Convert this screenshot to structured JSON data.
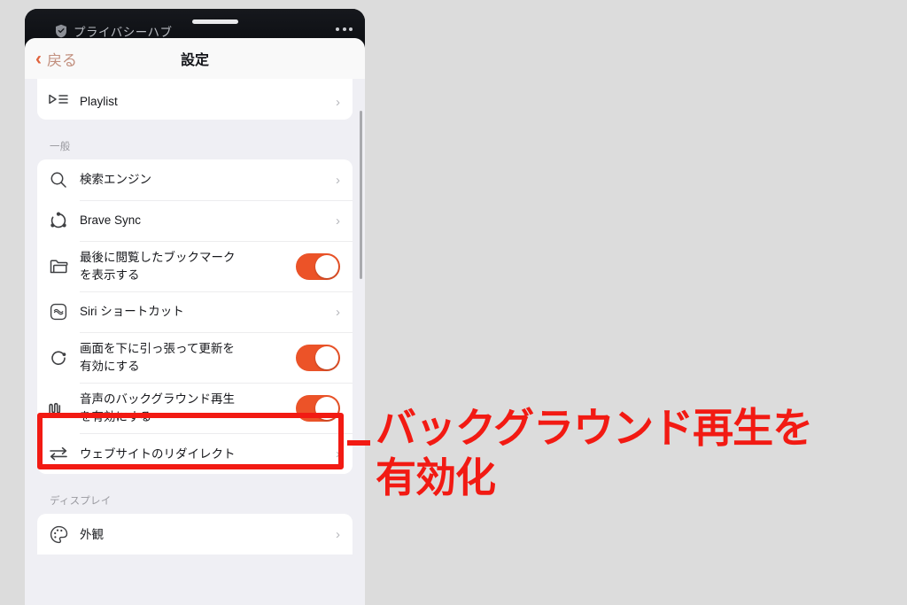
{
  "browser": {
    "hub_label": "プライバシーハブ",
    "shield_icon": "shield-icon",
    "menu_icon": "more-dots-icon",
    "tab_handle": "tab-grabber"
  },
  "navbar": {
    "back_chevron": "‹",
    "back_label": "戻る",
    "title": "設定"
  },
  "sections": [
    {
      "header": null,
      "rows": [
        {
          "icon": "playlist-icon",
          "label_line1": "Playlist",
          "label_line2": "",
          "accessory": "chevron",
          "toggle_on": false
        }
      ]
    },
    {
      "header": "一般",
      "rows": [
        {
          "icon": "search-icon",
          "label_line1": "検索エンジン",
          "label_line2": "",
          "accessory": "chevron",
          "toggle_on": false
        },
        {
          "icon": "sync-icon",
          "label_line1": "Brave Sync",
          "label_line2": "",
          "accessory": "chevron",
          "toggle_on": false
        },
        {
          "icon": "folder-icon",
          "label_line1": "最後に閲覧したブックマーク",
          "label_line2": "を表示する",
          "accessory": "toggle",
          "toggle_on": true
        },
        {
          "icon": "siri-shortcut-icon",
          "label_line1": "Siri ショートカット",
          "label_line2": "",
          "accessory": "chevron",
          "toggle_on": false
        },
        {
          "icon": "refresh-icon",
          "label_line1": "画面を下に引っ張って更新を",
          "label_line2": "有効にする",
          "accessory": "toggle",
          "toggle_on": true
        },
        {
          "icon": "audio-waveform-icon",
          "label_line1": "音声のバックグラウンド再生",
          "label_line2": "を有効にする",
          "accessory": "toggle",
          "toggle_on": true
        },
        {
          "icon": "redirect-icon",
          "label_line1": "ウェブサイトのリダイレクト",
          "label_line2": "",
          "accessory": "chevron",
          "toggle_on": false
        }
      ]
    },
    {
      "header": "ディスプレイ",
      "rows": [
        {
          "icon": "appearance-palette-icon",
          "label_line1": "外観",
          "label_line2": "",
          "accessory": "chevron",
          "toggle_on": false
        }
      ]
    }
  ],
  "annotation": {
    "text": "バックグラウンド再生を\n有効化",
    "color": "#f21a13",
    "highlight_target": "音声のバックグラウンド再生を有効にする"
  },
  "colors": {
    "page_background": "#dcdcdc",
    "sheet_background": "#efeff4",
    "card_background": "#ffffff",
    "toggle_on": "#ec5328",
    "accent_back": "#e0623c",
    "annotation_red": "#f21a13"
  }
}
